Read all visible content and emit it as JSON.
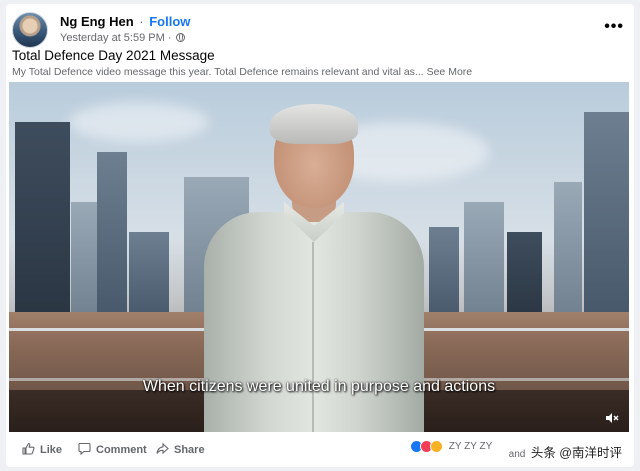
{
  "post": {
    "author": "Ng Eng Hen",
    "follow_label": "Follow",
    "timestamp": "Yesterday at 5:59 PM",
    "title": "Total Defence Day 2021 Message",
    "description": "My Total Defence video message this year. Total Defence remains relevant and vital as...",
    "see_more_label": "See More"
  },
  "video": {
    "caption": "When citizens were united in purpose and actions"
  },
  "actions": {
    "like_label": "Like",
    "comment_label": "Comment",
    "share_label": "Share"
  },
  "reactions": {
    "names": "ZY ZY ZY",
    "and_label": "and"
  },
  "watermark": "头条 @南洋时评",
  "colors": {
    "link_blue": "#1877f2",
    "secondary_text": "#65676b"
  }
}
